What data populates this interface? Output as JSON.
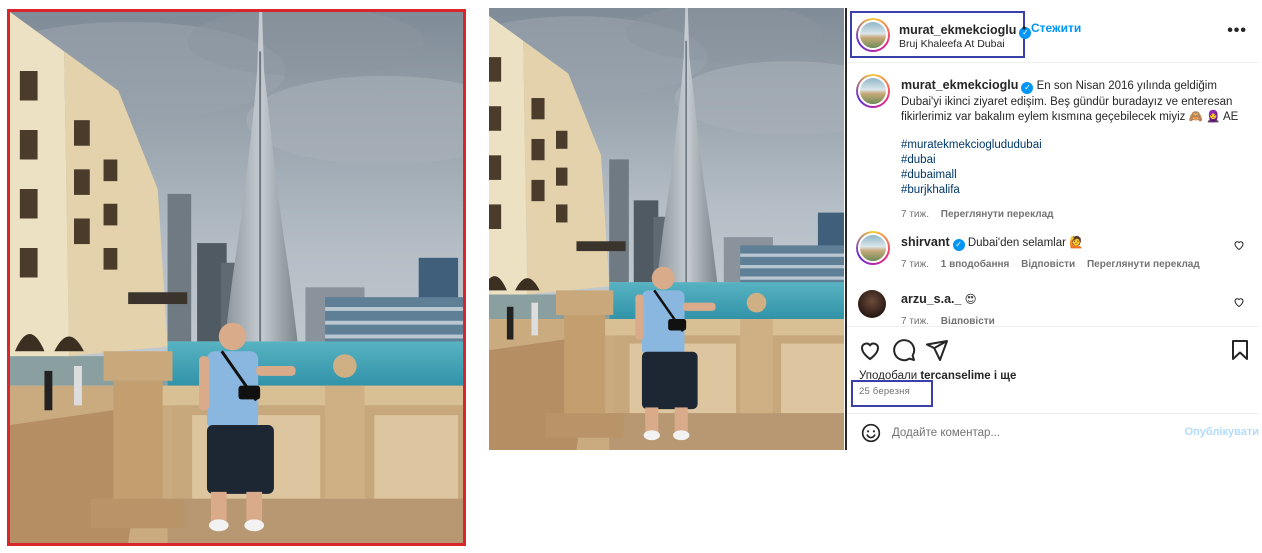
{
  "post": {
    "username": "murat_ekmekcioglu",
    "follow_label": "Стежити",
    "separator": "•",
    "location": "Bruj Khaleefa At Dubai",
    "more_label": "•••"
  },
  "caption": {
    "username": "murat_ekmekcioglu",
    "text": "En son Nisan 2016 yılında geldiğim Dubai'yi ikinci ziyaret edişim. Beş gündür buradayız ve enteresan fikirlerimiz var bakalım eylem kısmına geçebilecek miyiz 🙈 🧕 AE",
    "hashtags": [
      "#muratekmekcioglududubai",
      "#dubai",
      "#dubaimall",
      "#burjkhalifa"
    ],
    "time": "7 тиж.",
    "translate": "Переглянути переклад"
  },
  "comments": [
    {
      "username": "shirvant",
      "text": "Dubai'den selamlar 🙋",
      "time": "7 тиж.",
      "likes": "1 вподобання",
      "reply": "Відповісти",
      "translate": "Переглянути переклад",
      "verified": true
    },
    {
      "username": "arzu_s.a._",
      "text": "😍",
      "time": "7 тиж.",
      "reply": "Відповісти",
      "verified": false
    }
  ],
  "likes": {
    "prefix": "Уподобали",
    "user": "tercanselime",
    "suffix": "і ще"
  },
  "date": "25 березня",
  "add_comment": {
    "placeholder": "Додайте коментар...",
    "publish_label": "Опублікувати"
  },
  "colors": {
    "highlight_left": "#d9262d",
    "highlight_box": "#3b3fa8",
    "link": "#0095f6",
    "hashtag": "#00376b"
  },
  "icons": [
    "heart-icon",
    "comment-icon",
    "share-icon",
    "bookmark-icon",
    "emoji-icon",
    "verified-icon",
    "more-icon"
  ]
}
